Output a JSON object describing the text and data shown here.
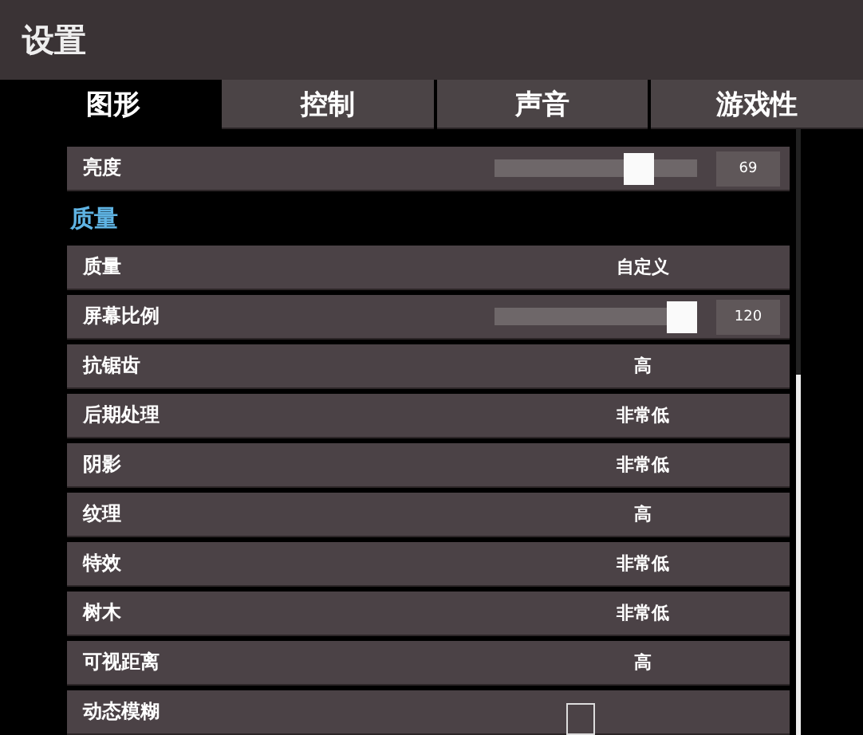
{
  "window": {
    "title": "设置"
  },
  "tabs": [
    {
      "label": "图形",
      "selected": true
    },
    {
      "label": "控制",
      "selected": false
    },
    {
      "label": "声音",
      "selected": false
    },
    {
      "label": "游戏性",
      "selected": false
    }
  ],
  "top_rows": [
    {
      "kind": "slider",
      "label": "亮度",
      "level": 0.75,
      "reading": "69"
    }
  ],
  "section": {
    "title": "质量"
  },
  "rows": [
    {
      "kind": "choice",
      "label": "质量",
      "value": "自定义"
    },
    {
      "kind": "slider",
      "label": "屏幕比例",
      "level": 1,
      "reading": "120"
    },
    {
      "kind": "choice",
      "label": "抗锯齿",
      "value": "高"
    },
    {
      "kind": "choice",
      "label": "后期处理",
      "value": "非常低"
    },
    {
      "kind": "choice",
      "label": "阴影",
      "value": "非常低"
    },
    {
      "kind": "choice",
      "label": "纹理",
      "value": "高"
    },
    {
      "kind": "choice",
      "label": "特效",
      "value": "非常低"
    },
    {
      "kind": "choice",
      "label": "树木",
      "value": "非常低"
    },
    {
      "kind": "choice",
      "label": "可视距离",
      "value": "高"
    },
    {
      "kind": "checkbox",
      "label": "动态模糊",
      "checked": false
    }
  ]
}
